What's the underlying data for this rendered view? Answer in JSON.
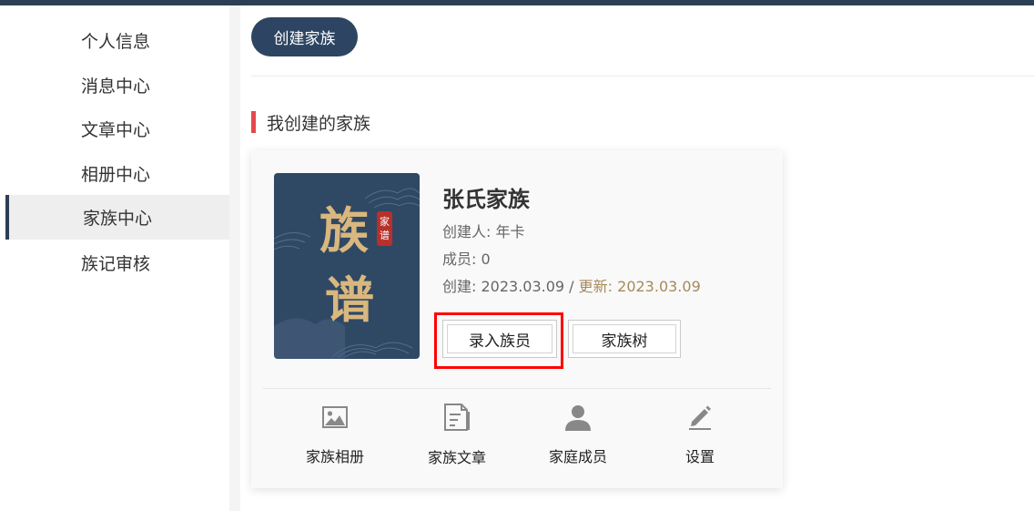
{
  "sidebar": {
    "items": [
      {
        "label": "个人信息",
        "active": false
      },
      {
        "label": "消息中心",
        "active": false
      },
      {
        "label": "文章中心",
        "active": false
      },
      {
        "label": "相册中心",
        "active": false
      },
      {
        "label": "家族中心",
        "active": true
      },
      {
        "label": "族记审核",
        "active": false
      }
    ]
  },
  "toolbar": {
    "create_label": "创建家族"
  },
  "section": {
    "title": "我创建的家族"
  },
  "family": {
    "cover": {
      "title_chars": [
        "族",
        "谱"
      ],
      "seal_chars": [
        "家",
        "谱"
      ]
    },
    "name": "张氏家族",
    "creator": "创建人: 年卡",
    "members": "成员: 0",
    "created": "创建: 2023.03.09",
    "separator": " / ",
    "updated": "更新: 2023.03.09",
    "buttons": {
      "record": "录入族员",
      "tree": "家族树"
    },
    "actions": [
      {
        "label": "家族相册",
        "icon": "image-icon"
      },
      {
        "label": "家族文章",
        "icon": "document-icon"
      },
      {
        "label": "家庭成员",
        "icon": "user-icon"
      },
      {
        "label": "设置",
        "icon": "pencil-icon"
      }
    ]
  },
  "colors": {
    "primary": "#2d4562",
    "accent_red": "#e5484d",
    "gold": "#d9b77e",
    "highlight": "#ff0000"
  }
}
